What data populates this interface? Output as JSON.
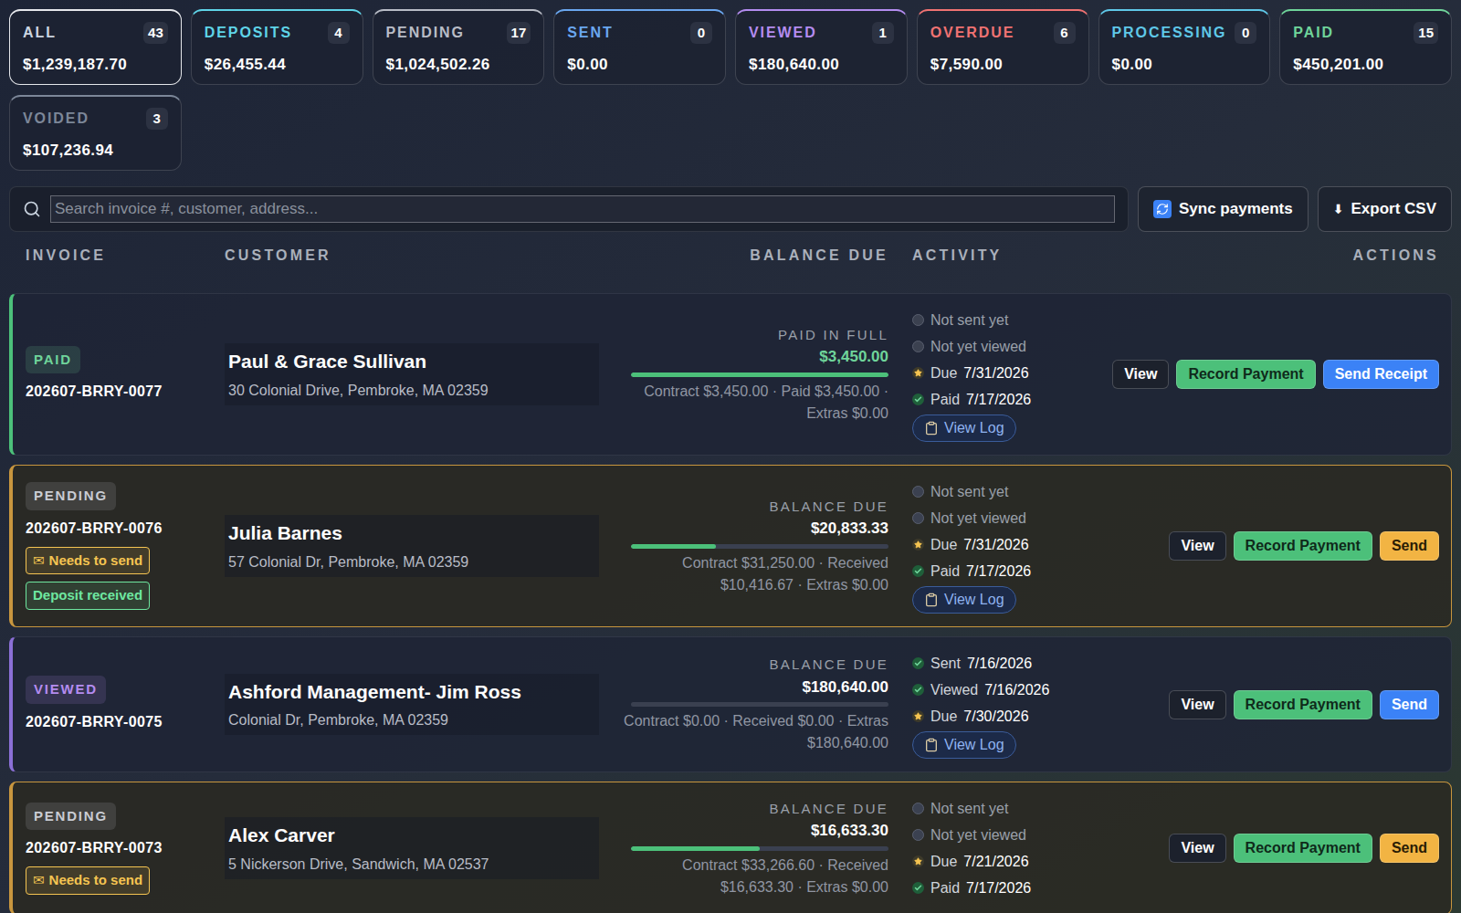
{
  "cards": [
    {
      "label": "ALL",
      "count": "43",
      "amount": "$1,239,187.70",
      "color": "#cbd5e1",
      "selected": true
    },
    {
      "label": "DEPOSITS",
      "count": "4",
      "amount": "$26,455.44",
      "color": "#5fd4e8",
      "selected": false
    },
    {
      "label": "PENDING",
      "count": "17",
      "amount": "$1,024,502.26",
      "color": "#b8bcc6",
      "selected": false
    },
    {
      "label": "SENT",
      "count": "0",
      "amount": "$0.00",
      "color": "#6aa7f0",
      "selected": false
    },
    {
      "label": "VIEWED",
      "count": "1",
      "amount": "$180,640.00",
      "color": "#b48cf0",
      "selected": false
    },
    {
      "label": "OVERDUE",
      "count": "6",
      "amount": "$7,590.00",
      "color": "#f07272",
      "selected": false
    },
    {
      "label": "PROCESSING",
      "count": "0",
      "amount": "$0.00",
      "color": "#5fc8e8",
      "selected": false
    },
    {
      "label": "PAID",
      "count": "15",
      "amount": "$450,201.00",
      "color": "#6fd49a",
      "selected": false
    },
    {
      "label": "VOIDED",
      "count": "3",
      "amount": "$107,236.94",
      "color": "#7c8799",
      "selected": false
    }
  ],
  "search": {
    "placeholder": "Search invoice #, customer, address..."
  },
  "toolbar": {
    "sync": "Sync payments",
    "export": "Export CSV",
    "export_icon": "⬇"
  },
  "table": {
    "columns": [
      "INVOICE",
      "CUSTOMER",
      "BALANCE DUE",
      "ACTIVITY",
      "ACTIONS"
    ],
    "rows": [
      {
        "status": "PAID",
        "status_color": "#6fd49a",
        "accent": "#4cc07a",
        "outlined": false,
        "invoice": "202607-BRRY-0077",
        "tags": [],
        "customer": "Paul & Grace Sullivan",
        "address": "30 Colonial Drive, Pembroke, MA 02359",
        "balance_label": "PAID IN FULL",
        "balance": "$3,450.00",
        "balance_color": "#6fd49a",
        "level": 1,
        "contract": "Contract $3,450.00 · Paid $3,450.00 · Extras $0.00",
        "activity": [
          {
            "label": "Not sent yet",
            "kind": "pending"
          },
          {
            "label": "Not yet viewed",
            "kind": "pending"
          },
          {
            "label": "Due",
            "date": "7/31/2026",
            "kind": "due"
          },
          {
            "label": "Paid",
            "date": "7/17/2026",
            "kind": "done"
          }
        ],
        "log": "View Log",
        "actions": [
          {
            "label": "View",
            "color": "#1c212c",
            "text_color": "#ffffff"
          },
          {
            "label": "Record Payment",
            "color": "#4cc07a",
            "text_color": "#0f2a1a"
          },
          {
            "label": "Send Receipt",
            "color": "#3b82f6",
            "text_color": "#ffffff"
          }
        ]
      },
      {
        "status": "PENDING",
        "status_color": "#c9ccd3",
        "accent": "#c8963e",
        "outlined": true,
        "invoice": "202607-BRRY-0076",
        "tags": [
          {
            "icon": "✉",
            "label": "Needs to send",
            "color": "#f5c451"
          },
          {
            "label": "Deposit received",
            "color": "#6ee7a0"
          }
        ],
        "customer": "Julia Barnes",
        "address": "57 Colonial Dr, Pembroke, MA 02359",
        "balance_label": "BALANCE DUE",
        "balance": "$20,833.33",
        "balance_color": "#ffffff",
        "level": 0.33,
        "contract": "Contract $31,250.00 · Received $10,416.67 · Extras $0.00",
        "activity": [
          {
            "label": "Not sent yet",
            "kind": "pending"
          },
          {
            "label": "Not yet viewed",
            "kind": "pending"
          },
          {
            "label": "Due",
            "date": "7/31/2026",
            "kind": "due"
          },
          {
            "label": "Paid",
            "date": "7/17/2026",
            "kind": "done"
          }
        ],
        "log": "View Log",
        "actions": [
          {
            "label": "View",
            "color": "#1c212c",
            "text_color": "#ffffff"
          },
          {
            "label": "Record Payment",
            "color": "#4cc07a",
            "text_color": "#0f2a1a"
          },
          {
            "label": "Send",
            "color": "#f2b443",
            "text_color": "#2a1c05"
          }
        ]
      },
      {
        "status": "VIEWED",
        "status_color": "#b48cf0",
        "accent": "#8b6fd6",
        "outlined": false,
        "invoice": "202607-BRRY-0075",
        "tags": [],
        "customer": "Ashford Management- Jim Ross",
        "address": "Colonial Dr, Pembroke, MA 02359",
        "balance_label": "BALANCE DUE",
        "balance": "$180,640.00",
        "balance_color": "#ffffff",
        "level": 0,
        "contract": "Contract $0.00 · Received $0.00 · Extras $180,640.00",
        "activity": [
          {
            "label": "Sent",
            "date": "7/16/2026",
            "kind": "done"
          },
          {
            "label": "Viewed",
            "date": "7/16/2026",
            "kind": "done"
          },
          {
            "label": "Due",
            "date": "7/30/2026",
            "kind": "due"
          }
        ],
        "log": "View Log",
        "actions": [
          {
            "label": "View",
            "color": "#1c212c",
            "text_color": "#ffffff"
          },
          {
            "label": "Record Payment",
            "color": "#4cc07a",
            "text_color": "#0f2a1a"
          },
          {
            "label": "Send",
            "color": "#3b82f6",
            "text_color": "#ffffff"
          }
        ]
      },
      {
        "status": "PENDING",
        "status_color": "#c9ccd3",
        "accent": "#c8963e",
        "outlined": true,
        "invoice": "202607-BRRY-0073",
        "tags": [
          {
            "icon": "✉",
            "label": "Needs to send",
            "color": "#f5c451"
          }
        ],
        "customer": "Alex Carver",
        "address": "5 Nickerson Drive, Sandwich, MA 02537",
        "balance_label": "BALANCE DUE",
        "balance": "$16,633.30",
        "balance_color": "#ffffff",
        "level": 0.5,
        "contract": "Contract $33,266.60 · Received $16,633.30 · Extras $0.00",
        "activity": [
          {
            "label": "Not sent yet",
            "kind": "pending"
          },
          {
            "label": "Not yet viewed",
            "kind": "pending"
          },
          {
            "label": "Due",
            "date": "7/21/2026",
            "kind": "due"
          },
          {
            "label": "Paid",
            "date": "7/17/2026",
            "kind": "done"
          }
        ],
        "actions": [
          {
            "label": "View",
            "color": "#1c212c",
            "text_color": "#ffffff"
          },
          {
            "label": "Record Payment",
            "color": "#4cc07a",
            "text_color": "#0f2a1a"
          },
          {
            "label": "Send",
            "color": "#f2b443",
            "text_color": "#2a1c05"
          }
        ]
      }
    ]
  }
}
